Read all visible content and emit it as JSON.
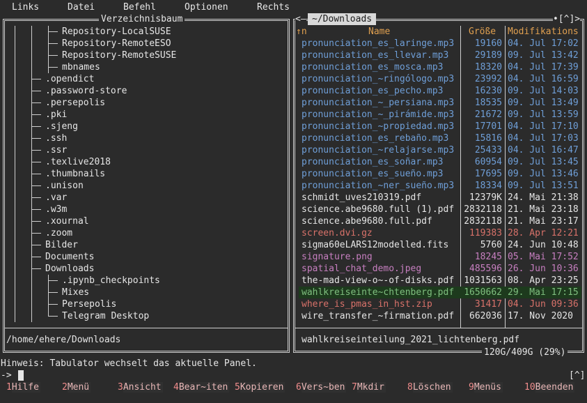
{
  "menubar": {
    "items": [
      "Links",
      "Datei",
      "Befehl",
      "Optionen",
      "Rechts"
    ]
  },
  "left_panel": {
    "title": "Verzeichnisbaum",
    "path": "/home/ehere/Downloads",
    "tree": [
      {
        "name": "Repository-LocalSUSE"
      },
      {
        "name": "Repository-RemoteESO"
      },
      {
        "name": "Repository-RemoteSUSE"
      },
      {
        "name": "mbnames"
      },
      {
        "name": ".opendict"
      },
      {
        "name": ".password-store"
      },
      {
        "name": ".persepolis"
      },
      {
        "name": ".pki"
      },
      {
        "name": ".sjeng"
      },
      {
        "name": ".ssh"
      },
      {
        "name": ".ssr"
      },
      {
        "name": ".texlive2018"
      },
      {
        "name": ".thumbnails"
      },
      {
        "name": ".unison"
      },
      {
        "name": ".var"
      },
      {
        "name": ".w3m"
      },
      {
        "name": ".xournal"
      },
      {
        "name": ".zoom"
      },
      {
        "name": "Bilder"
      },
      {
        "name": "Documents"
      },
      {
        "name": "Downloads"
      },
      {
        "name": ".ipynb_checkpoints"
      },
      {
        "name": "Mixes"
      },
      {
        "name": "Persepolis"
      },
      {
        "name": "Telegram Desktop"
      }
    ]
  },
  "right_panel": {
    "title": "~/Downloads",
    "left_marker": "<—",
    "right_marker": "•[^]>",
    "headers": {
      "sort": "↑n",
      "name": "Name",
      "size": "Größe",
      "modified": "Modifikations"
    },
    "files": [
      {
        "name": "pronunciation_es_laringe.mp3",
        "size": "19160",
        "date": "04. Jul 17:02",
        "color": "#6f9fd8"
      },
      {
        "name": "pronunciation_es_llevar.mp3",
        "size": "29189",
        "date": "09. Jul 13:42",
        "color": "#6f9fd8"
      },
      {
        "name": "pronunciation_es_mosca.mp3",
        "size": "18320",
        "date": "04. Jul 17:39",
        "color": "#6f9fd8"
      },
      {
        "name": "pronunciation_~ringólogo.mp3",
        "size": "23992",
        "date": "04. Jul 16:59",
        "color": "#6f9fd8"
      },
      {
        "name": "pronunciation_es_pecho.mp3",
        "size": "16230",
        "date": "09. Jul 14:03",
        "color": "#6f9fd8"
      },
      {
        "name": "pronunciation_~_persiana.mp3",
        "size": "18535",
        "date": "09. Jul 13:49",
        "color": "#6f9fd8"
      },
      {
        "name": "pronunciation_~_pirámide.mp3",
        "size": "21672",
        "date": "09. Jul 13:59",
        "color": "#6f9fd8"
      },
      {
        "name": "pronunciation_~propiedad.mp3",
        "size": "17701",
        "date": "04. Jul 17:10",
        "color": "#6f9fd8"
      },
      {
        "name": "pronunciation_es_rebaño.mp3",
        "size": "15816",
        "date": "04. Jul 17:03",
        "color": "#6f9fd8"
      },
      {
        "name": "pronunciation_~relajarse.mp3",
        "size": "25433",
        "date": "04. Jul 16:47",
        "color": "#6f9fd8"
      },
      {
        "name": "pronunciation_es_soñar.mp3",
        "size": "60954",
        "date": "09. Jul 13:45",
        "color": "#6f9fd8"
      },
      {
        "name": "pronunciation_es_sueño.mp3",
        "size": "17695",
        "date": "09. Jul 13:46",
        "color": "#6f9fd8"
      },
      {
        "name": "pronunciation_~ner_sueño.mp3",
        "size": "18334",
        "date": "09. Jul 13:51",
        "color": "#6f9fd8"
      },
      {
        "name": "schmidt_uves210319.pdf",
        "size": "12379K",
        "date": "24. Mai 21:38",
        "color": "#e6e6e6"
      },
      {
        "name": "science.abe9680.full (1).pdf",
        "size": "2832118",
        "date": "21. Mai 23:18",
        "color": "#e6e6e6"
      },
      {
        "name": "science.abe9680.full.pdf",
        "size": "2832118",
        "date": "21. Mai 23:17",
        "color": "#e6e6e6"
      },
      {
        "name": "screen.dvi.gz",
        "size": "119383",
        "date": "28. Apr 12:21",
        "color": "#d9726a"
      },
      {
        "name": "sigma60eLARS12modelled.fits",
        "size": "5760",
        "date": "24. Jun 10:48",
        "color": "#e6e6e6"
      },
      {
        "name": "signature.png",
        "size": "18245",
        "date": "05. Mai 17:52",
        "color": "#c77fc0"
      },
      {
        "name": "spatial_chat_demo.jpeg",
        "size": "485596",
        "date": "26. Jun 10:36",
        "color": "#c77fc0"
      },
      {
        "name": "the-mad-view-o~-of-disks.pdf",
        "size": "1031563",
        "date": "08. Apr 23:25",
        "color": "#e6e6e6"
      },
      {
        "name": "wahlkreiseinte~chtenberg.pdf",
        "size": "1650662",
        "date": "29. Mai 17:15",
        "color": "#7fbf7f",
        "selected": true
      },
      {
        "name": "where_is_pmas_in_hst.zip",
        "size": "31417",
        "date": "04. Jun 09:36",
        "color": "#d9726a"
      },
      {
        "name": "wire_transfer_~firmation.pdf",
        "size": "662036",
        "date": "17. Nov 2020",
        "color": "#e6e6e6"
      }
    ],
    "current_file": "wahlkreiseinteilung_2021_lichtenberg.pdf",
    "disk_usage": "120G/409G (29%)"
  },
  "hint": "Hinweis: Tabulator wechselt das aktuelle Panel.",
  "command_line": {
    "prompt": "->",
    "value": "",
    "hist_marker": "[^]"
  },
  "function_keys": [
    {
      "num": "1",
      "label": "Hilfe"
    },
    {
      "num": "2",
      "label": "Menü"
    },
    {
      "num": "3",
      "label": "Ansicht"
    },
    {
      "num": "4",
      "label": "Bear~iten"
    },
    {
      "num": "5",
      "label": "Kopieren"
    },
    {
      "num": "6",
      "label": "Vers~ben"
    },
    {
      "num": "7",
      "label": "Mkdir"
    },
    {
      "num": "8",
      "label": "Löschen"
    },
    {
      "num": "9",
      "label": "Menüs"
    },
    {
      "num": "10",
      "label": "Beenden"
    }
  ]
}
